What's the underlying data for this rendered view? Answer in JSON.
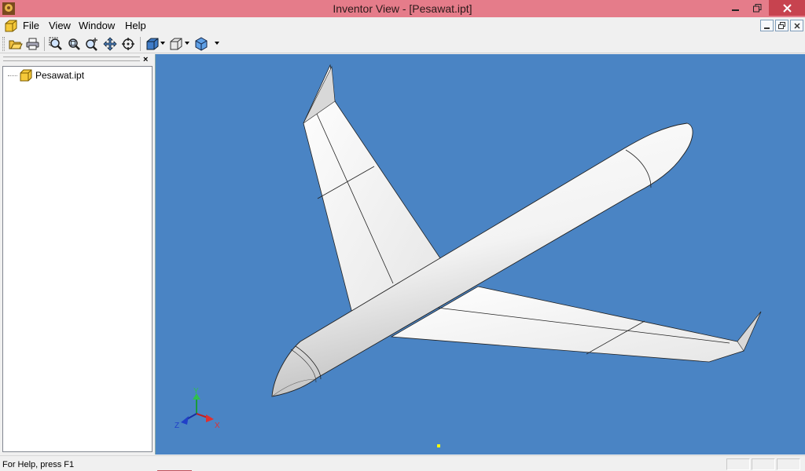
{
  "window": {
    "title": "Inventor View - [Pesawat.ipt]",
    "titlebar_color": "#e57c8a",
    "close_color": "#c7434f"
  },
  "menu": {
    "items": [
      "File",
      "View",
      "Window",
      "Help"
    ]
  },
  "toolbar": {
    "icons": [
      "open-icon",
      "print-icon",
      "zoom-all-icon",
      "zoom-window-icon",
      "zoom-icon",
      "pan-icon",
      "rotate-icon",
      "view-cube-icon",
      "display-mode-icon",
      "shading-icon"
    ]
  },
  "browser": {
    "close_label": "×",
    "tree": [
      {
        "label": "Pesawat.ipt",
        "icon": "part-icon"
      }
    ]
  },
  "viewport": {
    "background": "#4a84c4",
    "triad": {
      "x_label": "X",
      "y_label": "Y",
      "z_label": "Z"
    }
  },
  "status": {
    "text": "For Help, press F1"
  }
}
